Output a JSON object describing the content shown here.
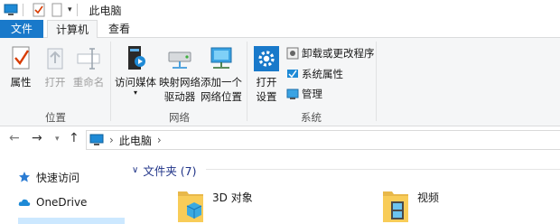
{
  "window": {
    "title": "此电脑"
  },
  "tabs": {
    "file": "文件",
    "computer": "计算机",
    "view": "查看"
  },
  "ribbon": {
    "location_group": {
      "label": "位置",
      "properties": "属性",
      "open": "打开",
      "rename": "重命名"
    },
    "network_group": {
      "label": "网络",
      "media_line1": "访问媒体",
      "map_line1": "映射网络",
      "map_line2": "驱动器",
      "add_line1": "添加一个",
      "add_line2": "网络位置"
    },
    "system_group": {
      "label": "系统",
      "open_settings_line1": "打开",
      "open_settings_line2": "设置",
      "uninstall": "卸载或更改程序",
      "system_props": "系统属性",
      "manage": "管理"
    }
  },
  "address": {
    "crumb": "此电脑",
    "separator": "›"
  },
  "navpane": {
    "quick_access": "快速访问",
    "onedrive": "OneDrive"
  },
  "content": {
    "section_title": "文件夹 (7)",
    "folders": [
      "3D 对象",
      "视频"
    ]
  },
  "colors": {
    "accent": "#1979ca",
    "section": "#1e3287",
    "folder": "#f8cc58"
  }
}
